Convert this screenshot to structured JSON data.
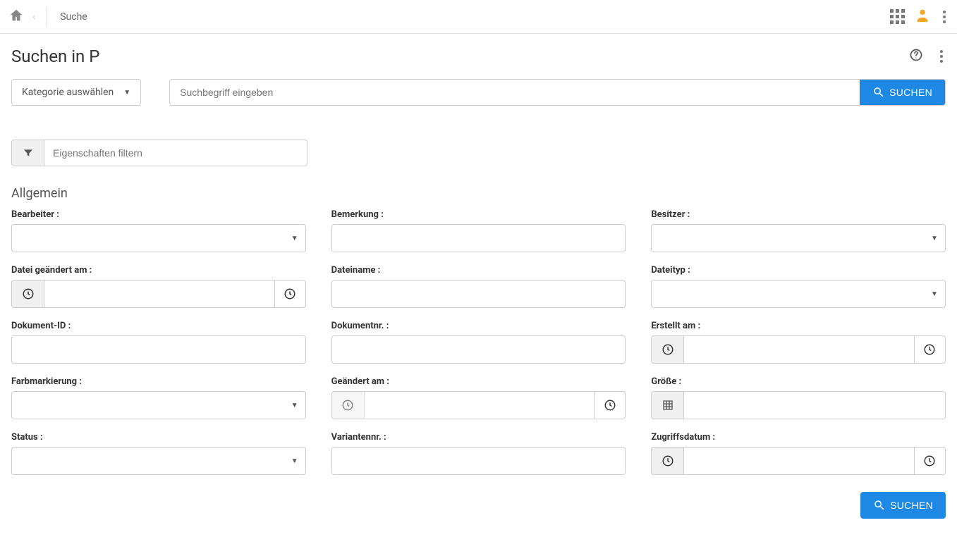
{
  "topbar": {
    "breadcrumb": "Suche"
  },
  "header": {
    "title": "Suchen in P"
  },
  "search": {
    "category_label": "Kategorie auswählen",
    "placeholder": "Suchbegriff eingeben",
    "button": "SUCHEN"
  },
  "filter": {
    "placeholder": "Eigenschaften filtern"
  },
  "section": {
    "title": "Allgemein"
  },
  "fields": {
    "bearbeiter": "Bearbeiter :",
    "bemerkung": "Bemerkung :",
    "besitzer": "Besitzer :",
    "datei_geaendert_am": "Datei geändert am :",
    "dateiname": "Dateiname :",
    "dateityp": "Dateityp :",
    "dokument_id": "Dokument-ID :",
    "dokumentnr": "Dokumentnr. :",
    "erstellt_am": "Erstellt am :",
    "farbmarkierung": "Farbmarkierung :",
    "geaendert_am": "Geändert am :",
    "groesse": "Größe :",
    "status": "Status :",
    "variantennr": "Variantennr. :",
    "zugriffsdatum": "Zugriffsdatum :"
  },
  "bottom": {
    "button": "SUCHEN"
  }
}
